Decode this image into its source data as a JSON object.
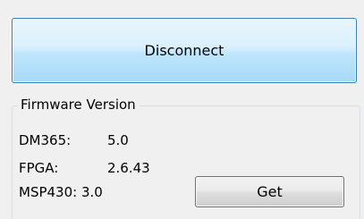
{
  "connection": {
    "button_label": "Disconnect"
  },
  "firmware": {
    "group_title": "Firmware Version",
    "rows": [
      {
        "label": "DM365:",
        "value": "5.0"
      },
      {
        "label": "FPGA:",
        "value": "2.6.43"
      },
      {
        "label": "MSP430:",
        "value": "3.0"
      }
    ],
    "get_label": "Get"
  },
  "colors": {
    "background": "#f0f0f0",
    "primary_button_border": "#3c7fb1",
    "primary_button_fill": "#bee6fd",
    "groupbox_border": "#d5dfe5"
  }
}
